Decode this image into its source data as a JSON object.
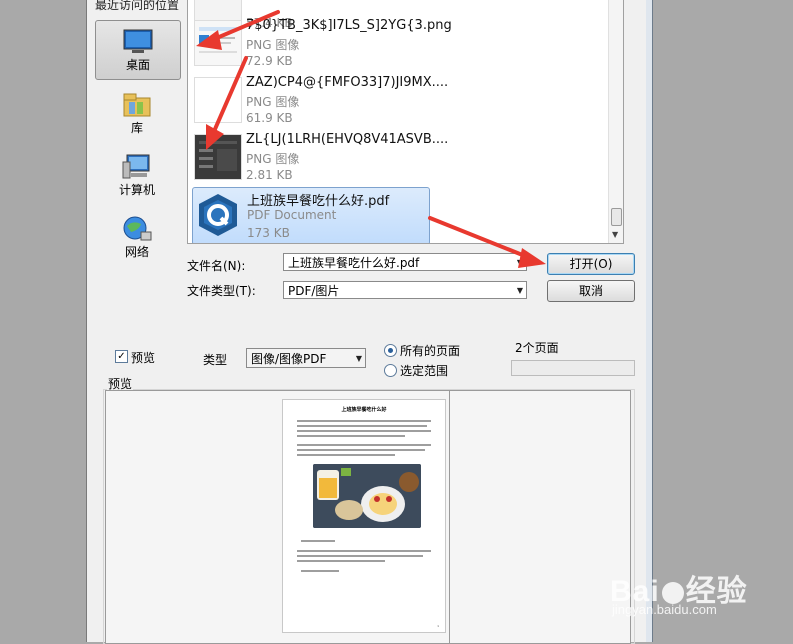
{
  "places": {
    "title": "最近访问的位置",
    "items": [
      {
        "label": "桌面",
        "icon": "desktop-icon",
        "active": true
      },
      {
        "label": "库",
        "icon": "library-icon"
      },
      {
        "label": "计算机",
        "icon": "computer-icon"
      },
      {
        "label": "网络",
        "icon": "network-icon"
      }
    ]
  },
  "files": [
    {
      "name": "",
      "type": "",
      "size": "57.4 KB"
    },
    {
      "name": "7$0}TB_3K$]I7LS_S]2YG{3.png",
      "type": "PNG 图像",
      "size": "72.9 KB"
    },
    {
      "name": "ZAZ)CP4@{FMFO33]7)JI9MX....",
      "type": "PNG 图像",
      "size": "61.9 KB"
    },
    {
      "name": "ZL{LJ(1LRH(EHVQ8V41ASVB....",
      "type": "PNG 图像",
      "size": "2.81 KB"
    },
    {
      "name": "上班族早餐吃什么好.pdf",
      "type": "PDF Document",
      "size": "173 KB",
      "selected": true
    }
  ],
  "form": {
    "filename_label": "文件名(N):",
    "filename_value": "上班族早餐吃什么好.pdf",
    "filetype_label": "文件类型(T):",
    "filetype_value": "PDF/图片",
    "open_button": "打开(O)",
    "cancel_button": "取消"
  },
  "options": {
    "preview_check": "预览",
    "type_label": "类型",
    "type_value": "图像/图像PDF",
    "radio_all": "所有的页面",
    "radio_range": "选定范围",
    "page_count": "2个页面",
    "preview_group": "预览"
  },
  "preview_page": {
    "title": "上班族早餐吃什么好"
  },
  "watermark": {
    "brand": "Bai",
    "brand2": "经验",
    "url": "jingyan.baidu.com"
  },
  "colors": {
    "arrow": "#e8392f",
    "selection": "#c1dcfc"
  }
}
